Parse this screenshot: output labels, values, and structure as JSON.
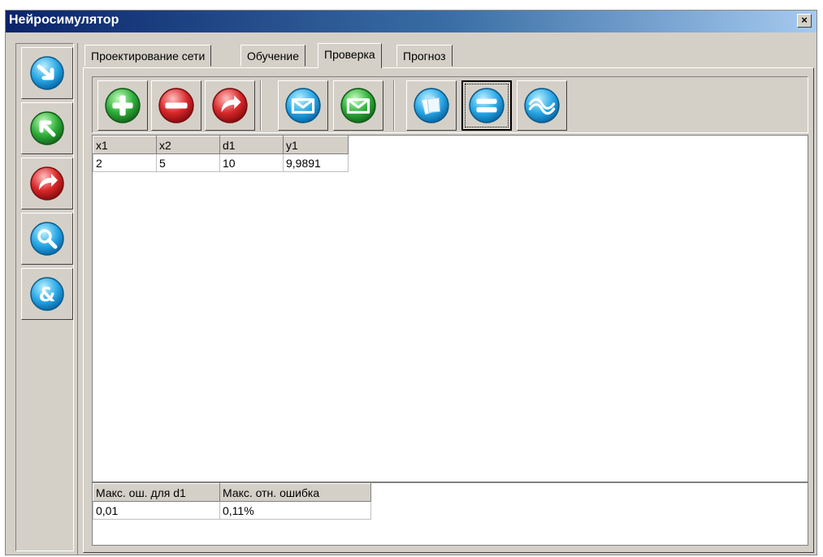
{
  "window": {
    "title": "Нейросимулятор",
    "close_label": "×"
  },
  "sidebar": {
    "buttons": [
      {
        "icon": "arrow-down-right-icon",
        "color": "#2a9fe0"
      },
      {
        "icon": "arrow-up-left-icon",
        "color": "#2aa83a"
      },
      {
        "icon": "redo-arrow-icon",
        "color": "#d8282a"
      },
      {
        "icon": "magnifier-icon",
        "color": "#2a9fe0"
      },
      {
        "icon": "ampersand-icon",
        "color": "#2a9fe0"
      }
    ]
  },
  "tabs": [
    {
      "label": "Проектирование сети",
      "active": false
    },
    {
      "label": "Обучение",
      "active": false
    },
    {
      "label": "Проверка",
      "active": true
    },
    {
      "label": "Прогноз",
      "active": false
    }
  ],
  "toolbar": {
    "buttons": [
      {
        "icon": "plus-icon",
        "color": "#2aa83a"
      },
      {
        "icon": "minus-icon",
        "color": "#d8282a"
      },
      {
        "icon": "redo-arrow-icon",
        "color": "#d8282a"
      },
      {
        "icon": "envelope-icon",
        "color": "#2a9fe0"
      },
      {
        "icon": "envelope-icon",
        "color": "#2aa83a"
      },
      {
        "icon": "pages-icon",
        "color": "#2a9fe0"
      },
      {
        "icon": "equals-icon",
        "color": "#2a9fe0",
        "pressed": true
      },
      {
        "icon": "wave-icon",
        "color": "#2a9fe0"
      }
    ]
  },
  "grid": {
    "columns": [
      "x1",
      "x2",
      "d1",
      "y1"
    ],
    "rows": [
      [
        "2",
        "5",
        "10",
        "9,9891"
      ]
    ]
  },
  "summary": {
    "columns": [
      "Макс. ош. для d1",
      "Макс. отн. ошибка"
    ],
    "values": [
      "0,01",
      "0,11%"
    ]
  }
}
